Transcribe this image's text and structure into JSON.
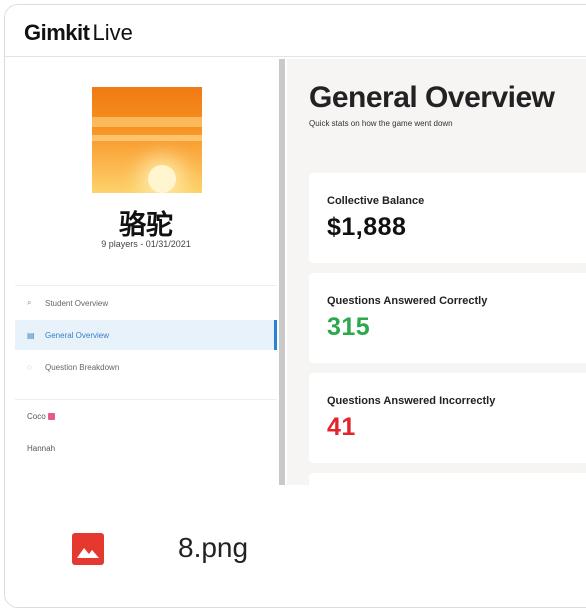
{
  "app": {
    "brand_bold": "Gimkit",
    "brand_light": "Live"
  },
  "game": {
    "title": "骆驼",
    "meta": "9 players - 01/31/2021"
  },
  "nav": [
    {
      "label": "Student Overview",
      "icon": "search-icon"
    },
    {
      "label": "General Overview",
      "icon": "list-icon",
      "active": true
    },
    {
      "label": "Question Breakdown",
      "icon": "question-icon"
    }
  ],
  "players": [
    "Coco",
    "Hannah"
  ],
  "main": {
    "title": "General Overview",
    "subtitle": "Quick stats on how the game went down",
    "stats": [
      {
        "label": "Collective Balance",
        "value": "$1,888"
      },
      {
        "label": "Questions Answered Correctly",
        "value": "315"
      },
      {
        "label": "Questions Answered Incorrectly",
        "value": "41"
      }
    ]
  },
  "file": {
    "name": "8.png",
    "icon": "image-file-icon"
  },
  "colors": {
    "correct": "#2aa84a",
    "incorrect": "#e0252c",
    "active_nav": "#2a82d4",
    "file_icon": "#e5382f"
  }
}
